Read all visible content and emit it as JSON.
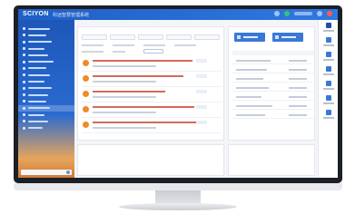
{
  "app": {
    "logo": "SCIYON",
    "subtitle": "科远智慧管理系统"
  },
  "colors": {
    "accent": "#2f79e0",
    "notice_icon": "#f08a24",
    "notice_text": "#d36a5b"
  },
  "icons": [
    "search-icon",
    "bell-icon",
    "user-icon",
    "settings-icon",
    "power-icon"
  ]
}
